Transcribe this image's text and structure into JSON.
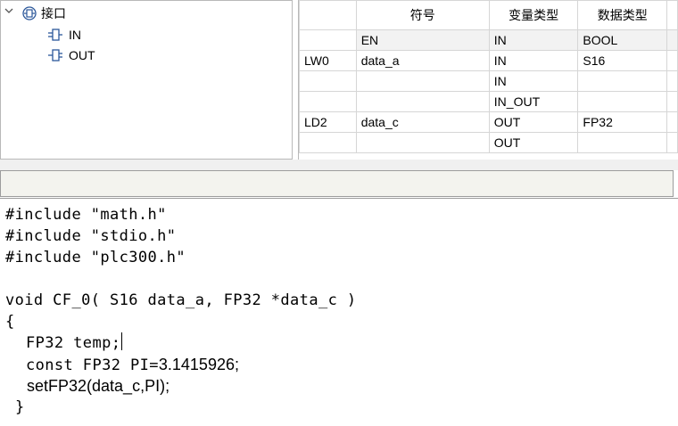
{
  "tree": {
    "root_label": "接口",
    "children": [
      "IN",
      "OUT"
    ]
  },
  "table": {
    "headers": [
      "",
      "符号",
      "变量类型",
      "数据类型",
      ""
    ],
    "rows": [
      [
        "",
        "EN",
        "IN",
        "BOOL",
        ""
      ],
      [
        "LW0",
        "data_a",
        "IN",
        "S16",
        ""
      ],
      [
        "",
        "",
        "IN",
        "",
        ""
      ],
      [
        "",
        "",
        "IN_OUT",
        "",
        ""
      ],
      [
        "LD2",
        "data_c",
        "OUT",
        "FP32",
        ""
      ],
      [
        "",
        "",
        "OUT",
        "",
        ""
      ]
    ]
  },
  "code": {
    "line1": "#include \"math.h\"",
    "line2": "#include \"stdio.h\"",
    "line3": "#include \"plc300.h\"",
    "line5": "void CF_0( S16 data_a, FP32 *data_c )",
    "line6": "{",
    "line7": "FP32 temp;",
    "line8a": "const FP32 PI=",
    "line8b": "3.1415926;",
    "line9": "setFP32(data_c,PI);",
    "line10": "}"
  },
  "colors": {
    "header_bg": "#ffffff",
    "en_row_bg": "#f2f2f2",
    "icon_blue": "#2b579a"
  }
}
